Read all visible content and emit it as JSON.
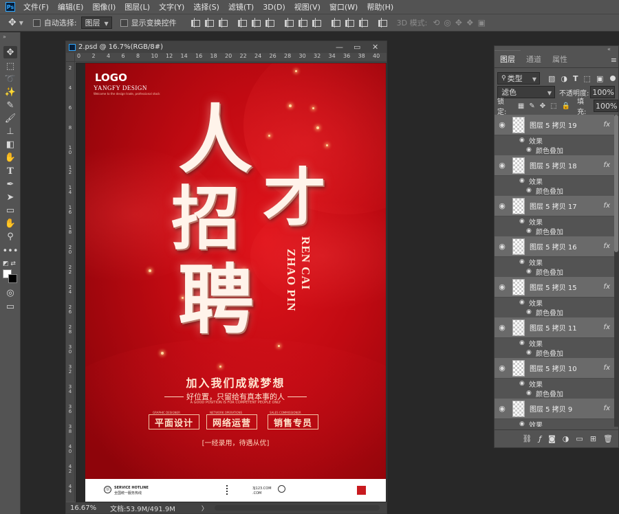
{
  "menubar": {
    "items": [
      "文件(F)",
      "编辑(E)",
      "图像(I)",
      "图层(L)",
      "文字(Y)",
      "选择(S)",
      "滤镜(T)",
      "3D(D)",
      "视图(V)",
      "窗口(W)",
      "帮助(H)"
    ]
  },
  "optbar": {
    "auto_select_label": "自动选择:",
    "auto_select_value": "图层",
    "show_transform_label": "显示变换控件",
    "mode_3d_label": "3D 模式:"
  },
  "document": {
    "tab_title": "2.psd @ 16.7%(RGB/8#)",
    "zoom": "16.67%",
    "doc_info": "文档:53.9M/491.9M",
    "ruler_top": [
      "0",
      "2",
      "4",
      "6",
      "8",
      "10",
      "12",
      "14",
      "16",
      "18",
      "20",
      "22",
      "24",
      "26",
      "28",
      "30",
      "32",
      "34",
      "36",
      "38",
      "40"
    ],
    "ruler_left": [
      "2",
      "4",
      "6",
      "8",
      "10",
      "12",
      "14",
      "16",
      "18",
      "20",
      "22",
      "24",
      "26",
      "28",
      "30",
      "32",
      "34",
      "36",
      "38",
      "40",
      "42",
      "44"
    ]
  },
  "poster": {
    "logo": "LOGO",
    "brand": "YANGFY DESIGN",
    "brand_tagline": "Welcome to the design trade, professional stock",
    "char1": "人",
    "char2": "才",
    "char3": "招",
    "char4": "聘",
    "vertical1": "REN CAI",
    "vertical2": "ZHAO PIN",
    "headline": "加入我们成就梦想",
    "subline": "好位置，只留给有真本事的人",
    "subline_en": "A GOOD POSITION IS FOR COMPETENT PEOPLE ONLY",
    "jobs": [
      {
        "en": "GRAPHIC DESIGNER",
        "cn": "平面设计"
      },
      {
        "en": "NETWORK OPERATIONS",
        "cn": "网络运营"
      },
      {
        "en": "SALES COMMISSIONER",
        "cn": "销售专员"
      }
    ],
    "promise": "[一经录用，待遇从优]",
    "hotline_en": "SERVICE HOTLINE",
    "hotline_cn": "全国统一服务热线",
    "web1": "3J123.COM",
    "web2": ".COM"
  },
  "layers_panel": {
    "tabs": [
      "图层",
      "通道",
      "属性"
    ],
    "filter_label": "类型",
    "blend_mode": "滤色",
    "opacity_label": "不透明度:",
    "opacity_value": "100%",
    "lock_label": "锁定:",
    "fill_label": "填充:",
    "fill_value": "100%",
    "effects_label": "效果",
    "effect_name": "颜色叠加",
    "fx_label": "fx",
    "layers": [
      "图层 5 拷贝 19",
      "图层 5 拷贝 18",
      "图层 5 拷贝 17",
      "图层 5 拷贝 16",
      "图层 5 拷贝 15",
      "图层 5 拷贝 11",
      "图层 5 拷贝 10",
      "图层 5 拷贝 9"
    ]
  }
}
